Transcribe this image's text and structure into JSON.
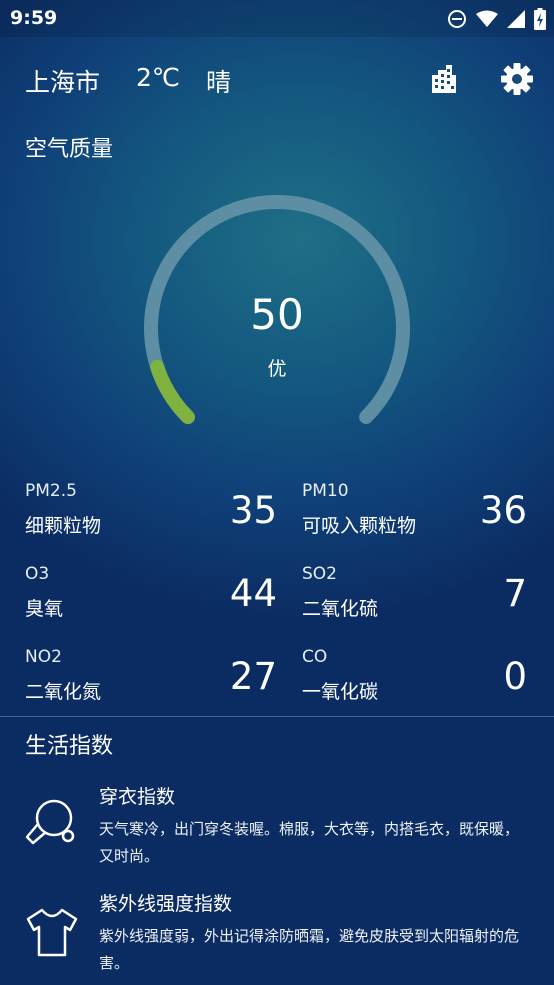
{
  "status_bar": {
    "time": "9:59",
    "icons": [
      "do-not-disturb-icon",
      "wifi-icon",
      "signal-icon",
      "battery-charging-icon"
    ]
  },
  "header": {
    "city": "上海市",
    "temperature": "2℃",
    "weather": "晴",
    "city_button_icon": "city-icon",
    "settings_button_icon": "gear-icon"
  },
  "air_quality": {
    "title": "空气质量",
    "aqi": "50",
    "level": "优",
    "gauge_fraction": 0.1,
    "colors": {
      "track": "#5e8ea3",
      "progress": "#7fb241"
    }
  },
  "pollutants": [
    {
      "code": "PM2.5",
      "name": "细颗粒物",
      "value": "35"
    },
    {
      "code": "PM10",
      "name": "可吸入颗粒物",
      "value": "36"
    },
    {
      "code": "O3",
      "name": "臭氧",
      "value": "44"
    },
    {
      "code": "SO2",
      "name": "二氧化硫",
      "value": "7"
    },
    {
      "code": "NO2",
      "name": "二氧化氮",
      "value": "27"
    },
    {
      "code": "CO",
      "name": "一氧化碳",
      "value": "0"
    }
  ],
  "life_index": {
    "title": "生活指数",
    "items": [
      {
        "icon": "ping-pong-icon",
        "name": "穿衣指数",
        "description": "天气寒冷，出门穿冬装喔。棉服，大衣等，内搭毛衣，既保暖，又时尚。"
      },
      {
        "icon": "t-shirt-icon",
        "name": "紫外线强度指数",
        "description": "紫外线强度弱，外出记得涂防晒霜，避免皮肤受到太阳辐射的危害。"
      }
    ]
  }
}
